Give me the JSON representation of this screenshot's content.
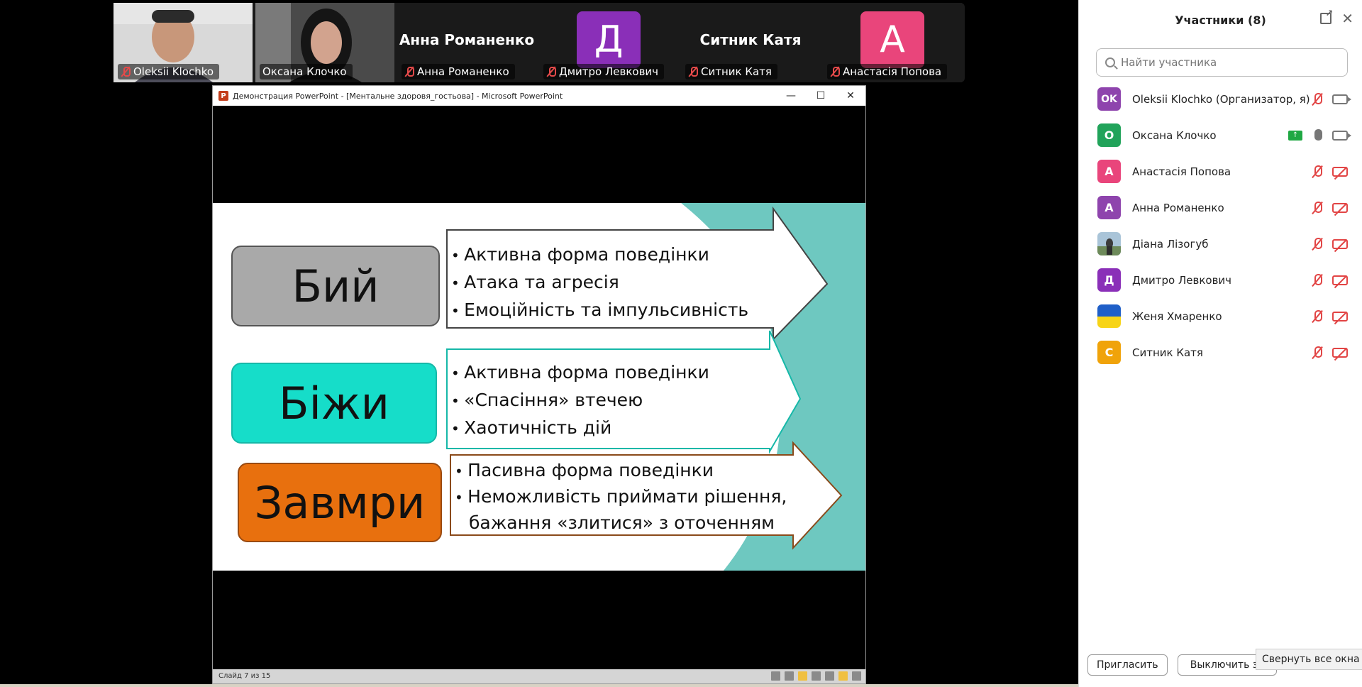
{
  "gallery": {
    "tiles": [
      {
        "name": "Oleksii Klochko",
        "muted": true
      },
      {
        "name": "Оксана Клочко",
        "muted": false
      },
      {
        "name": "Анна Романенко",
        "muted": true,
        "display_name": "Анна Романенко"
      },
      {
        "name": "Дмитро Левкович",
        "muted": true,
        "initial": "Д",
        "color": "#8a2fb8"
      },
      {
        "name": "Ситник Катя",
        "muted": true,
        "display_name": "Ситник Катя"
      },
      {
        "name": "Анастасія Попова",
        "muted": true,
        "initial": "А",
        "color": "#e9457b"
      }
    ]
  },
  "ppt": {
    "title": "Демонстрация PowerPoint - [Ментальне здоровя_гостьова] - Microsoft PowerPoint",
    "status": "Слайд 7 из 15",
    "controls": {
      "minimize": "—",
      "maximize": "☐",
      "close": "✕"
    }
  },
  "slide": {
    "rows": [
      {
        "label": "Бий",
        "bullets": [
          "Активна форма поведінки",
          "Атака та агресія",
          "Емоційність та  імпульсивність"
        ]
      },
      {
        "label": "Біжи",
        "bullets": [
          "Активна форма поведінки",
          "«Спасіння» втечею",
          "Хаотичність дій"
        ]
      },
      {
        "label": "Завмри",
        "bullets": [
          "Пасивна форма поведінки",
          "Неможливість приймати рішення,",
          "бажання «злитися»  з оточенням"
        ]
      }
    ],
    "colors": {
      "row1": "#a9a9a9",
      "row2": "#16ddc9",
      "row3": "#e8700e",
      "accent": "#6ec8c0"
    }
  },
  "panel": {
    "title": "Участники (8)",
    "search_placeholder": "Найти участника",
    "participants": [
      {
        "name": "Oleksii Klochko (Организатор, я)",
        "initials": "OK",
        "color": "#8e44ad",
        "mic": "off",
        "cam": "on"
      },
      {
        "name": "Оксана Клочко",
        "initials": "О",
        "color": "#21a35a",
        "mic": "on",
        "cam": "on",
        "sharing": true
      },
      {
        "name": "Анастасія Попова",
        "initials": "А",
        "color": "#e9457b",
        "mic": "off",
        "cam": "off"
      },
      {
        "name": "Анна Романенко",
        "initials": "А",
        "color": "#8e44ad",
        "mic": "off",
        "cam": "off"
      },
      {
        "name": "Діана Лізогуб",
        "initials": "",
        "color": "#9bb8cc",
        "mic": "off",
        "cam": "off"
      },
      {
        "name": "Дмитро Левкович",
        "initials": "Д",
        "color": "#8a2fb8",
        "mic": "off",
        "cam": "off"
      },
      {
        "name": "Женя Хмаренко",
        "initials": "",
        "color": "flag",
        "mic": "off",
        "cam": "off"
      },
      {
        "name": "Ситник Катя",
        "initials": "С",
        "color": "#f0a30a",
        "mic": "off",
        "cam": "off"
      }
    ],
    "buttons": {
      "invite": "Пригласить",
      "mute_all": "Выключить зв"
    },
    "tooltip": "Свернуть все окна"
  }
}
